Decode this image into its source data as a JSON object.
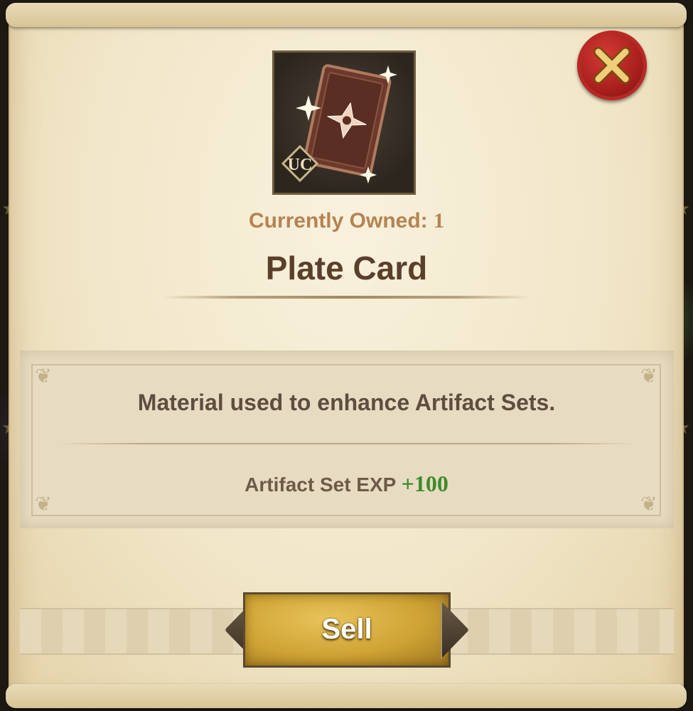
{
  "item": {
    "grade_badge": "UC",
    "name": "Plate Card",
    "owned_label": "Currently Owned:",
    "owned_count": "1",
    "description": "Material used to enhance Artifact Sets.",
    "stat_label": "Artifact Set EXP",
    "stat_value": "+100"
  },
  "actions": {
    "sell_label": "Sell"
  },
  "icons": {
    "close": "close-x-icon",
    "item": "plate-card-icon"
  },
  "colors": {
    "title": "#5a3f2c",
    "owned": "#b58352",
    "stat_value": "#3f8a2c",
    "sell_button": "#cfa334",
    "close_button": "#a51e1c"
  }
}
